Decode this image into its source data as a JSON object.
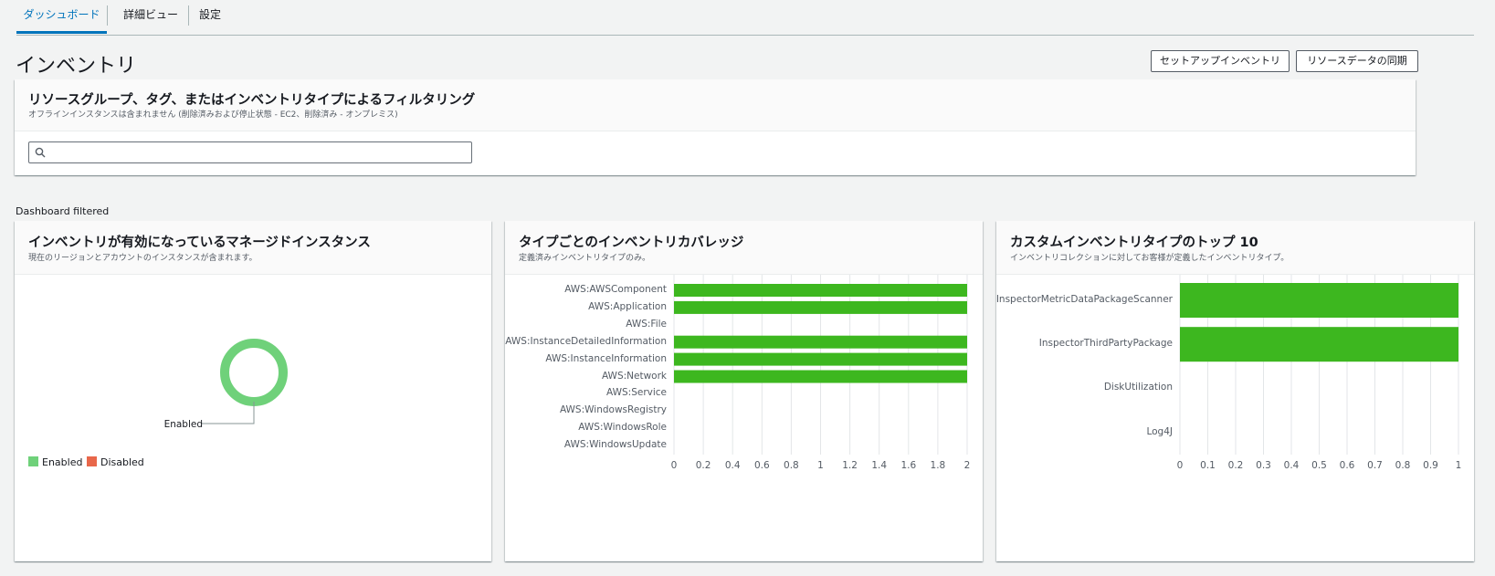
{
  "tabs": [
    {
      "label": "ダッシュボード",
      "active": true
    },
    {
      "label": "詳細ビュー",
      "active": false
    },
    {
      "label": "設定",
      "active": false
    }
  ],
  "page": {
    "title": "インベントリ",
    "setup_button": "セットアップインベントリ",
    "sync_button": "リソースデータの同期"
  },
  "filter": {
    "title": "リソースグループ、タグ、またはインベントリタイプによるフィルタリング",
    "subtitle": "オフラインインスタンスは含まれません (削除済みおよび停止状態 - EC2、削除済み - オンプレミス)",
    "search_value": "",
    "search_icon": "search-icon"
  },
  "dashboard_label": "Dashboard filtered",
  "colors": {
    "accent": "#0073bb",
    "enabled": "#6fd17a",
    "disabled": "#e8674a",
    "bar": "#3db71f"
  },
  "cards": {
    "managed": {
      "title": "インベントリが有効になっているマネージドインスタンス",
      "subtitle": "現在のリージョンとアカウントのインスタンスが含まれます。",
      "donut_label": "Enabled",
      "legend": [
        {
          "label": "Enabled",
          "color": "#6fd17a"
        },
        {
          "label": "Disabled",
          "color": "#e8674a"
        }
      ]
    },
    "coverage": {
      "title": "タイプごとのインベントリカバレッジ",
      "subtitle": "定義済みインベントリタイプのみ。"
    },
    "custom": {
      "title": "カスタムインベントリタイプのトップ 10",
      "subtitle": "インベントリコレクションに対してお客様が定義したインベントリタイプ。"
    }
  },
  "chart_data": [
    {
      "type": "pie",
      "categories": [
        "Enabled",
        "Disabled"
      ],
      "values": [
        1,
        0
      ],
      "donut": true
    },
    {
      "type": "bar",
      "orientation": "horizontal",
      "categories": [
        "AWS:AWSComponent",
        "AWS:Application",
        "AWS:File",
        "AWS:InstanceDetailedInformation",
        "AWS:InstanceInformation",
        "AWS:Network",
        "AWS:Service",
        "AWS:WindowsRegistry",
        "AWS:WindowsRole",
        "AWS:WindowsUpdate"
      ],
      "values": [
        2,
        2,
        0,
        2,
        2,
        2,
        0,
        0,
        0,
        0
      ],
      "xlim": [
        0,
        2
      ],
      "xticks": [
        "0",
        "0.2",
        "0.4",
        "0.6",
        "0.8",
        "1",
        "1.2",
        "1.4",
        "1.6",
        "1.8",
        "2"
      ],
      "grid": true
    },
    {
      "type": "bar",
      "orientation": "horizontal",
      "categories": [
        "InspectorMetricDataPackageScanner",
        "InspectorThirdPartyPackage",
        "DiskUtilization",
        "Log4J"
      ],
      "values": [
        1,
        1,
        0,
        0
      ],
      "xlim": [
        0,
        1
      ],
      "xticks": [
        "0",
        "0.1",
        "0.2",
        "0.3",
        "0.4",
        "0.5",
        "0.6",
        "0.7",
        "0.8",
        "0.9",
        "1"
      ],
      "grid": true
    }
  ]
}
